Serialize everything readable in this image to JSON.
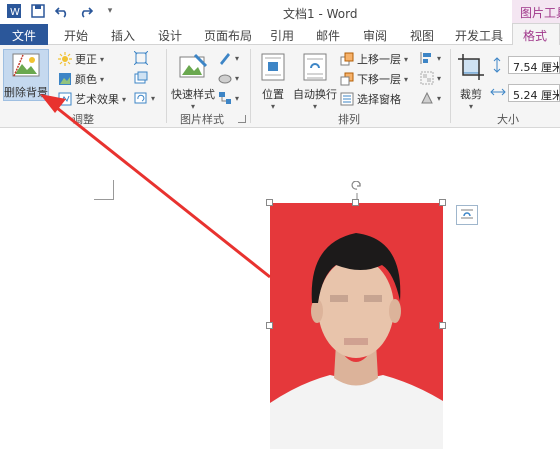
{
  "window": {
    "title": "文档1 - Word",
    "contextual_tab_group": "图片工具"
  },
  "tabs": {
    "file": "文件",
    "items": [
      "开始",
      "插入",
      "设计",
      "页面布局",
      "引用",
      "邮件",
      "审阅",
      "视图",
      "开发工具"
    ],
    "active": "格式"
  },
  "ribbon": {
    "adjust": {
      "label": "调整",
      "remove_background": "删除背景",
      "corrections": "更正",
      "color": "颜色",
      "artistic_effects": "艺术效果"
    },
    "picture_styles": {
      "label": "图片样式",
      "quick_styles": "快速样式"
    },
    "arrange": {
      "label": "排列",
      "position": "位置",
      "wrap_text": "自动换行",
      "bring_forward": "上移一层",
      "send_backward": "下移一层",
      "selection_pane": "选择窗格"
    },
    "size": {
      "label": "大小",
      "crop": "裁剪",
      "height": "7.54 厘米",
      "width": "5.24 厘米"
    }
  },
  "colors": {
    "file_tab": "#2b579a",
    "contextual": "#a0388b",
    "photo_bg": "#e5383b",
    "arrow": "#e8322f"
  }
}
